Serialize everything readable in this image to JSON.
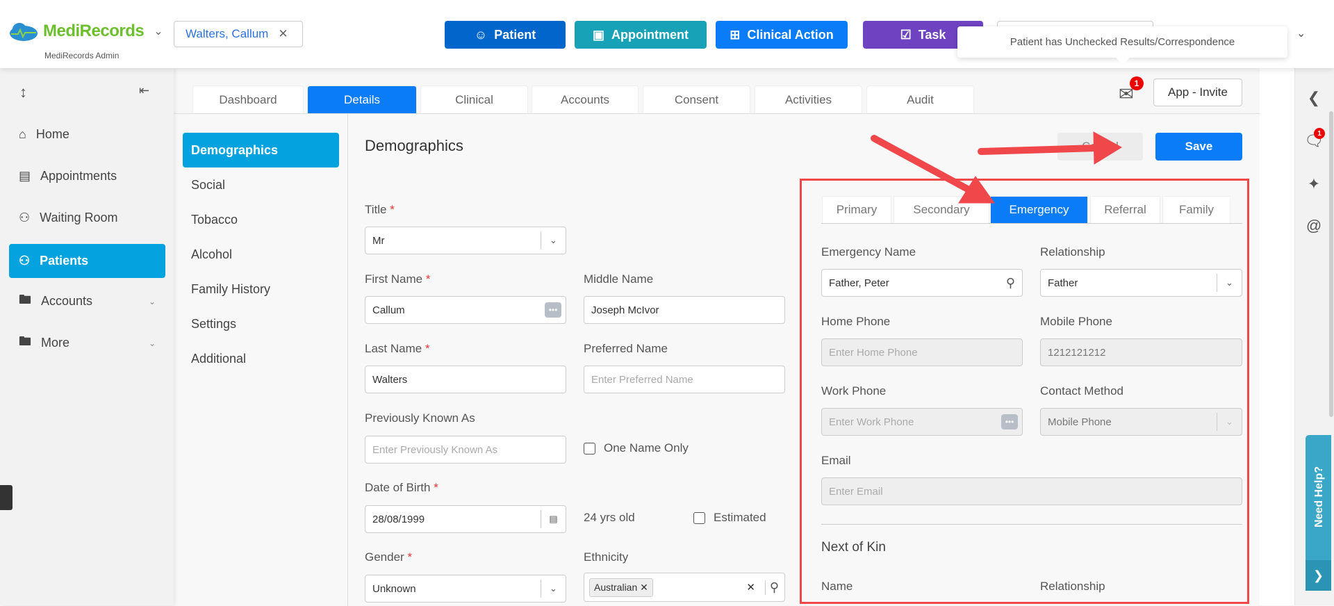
{
  "header": {
    "brand": "MediRecords",
    "subtitle": "MediRecords Admin",
    "patient_chip": "Walters, Callum",
    "buttons": [
      {
        "label": "Patient",
        "color": "#0066cc"
      },
      {
        "label": "Appointment",
        "color": "#17a2b8"
      },
      {
        "label": "Clinical Action",
        "color": "#0a7cf7"
      },
      {
        "label": "Task",
        "color": "#6f42c1"
      }
    ],
    "tooltip": "Patient has Unchecked Results/Correspondence"
  },
  "sidebar": {
    "items": [
      {
        "label": "Home"
      },
      {
        "label": "Appointments"
      },
      {
        "label": "Waiting Room"
      },
      {
        "label": "Patients"
      },
      {
        "label": "Accounts"
      },
      {
        "label": "More"
      }
    ]
  },
  "tabs": [
    "Dashboard",
    "Details",
    "Clinical",
    "Accounts",
    "Consent",
    "Activities",
    "Audit"
  ],
  "mail_badge": "1",
  "app_invite": "App - Invite",
  "subnav": [
    "Demographics",
    "Social",
    "Tobacco",
    "Alcohol",
    "Family History",
    "Settings",
    "Additional"
  ],
  "form": {
    "heading": "Demographics",
    "cancel": "Cancel",
    "save": "Save",
    "title_label": "Title",
    "title_value": "Mr",
    "first_name_label": "First Name",
    "first_name": "Callum",
    "middle_name_label": "Middle Name",
    "middle_name": "Joseph McIvor",
    "last_name_label": "Last Name",
    "last_name": "Walters",
    "preferred_label": "Preferred Name",
    "preferred_ph": "Enter Preferred Name",
    "pka_label": "Previously Known As",
    "pka_ph": "Enter Previously Known As",
    "one_name": "One Name Only",
    "dob_label": "Date of Birth",
    "dob": "28/08/1999",
    "age": "24 yrs old",
    "estimated": "Estimated",
    "gender_label": "Gender",
    "gender": "Unknown",
    "ethnicity_label": "Ethnicity",
    "ethnicity_tag": "Australian",
    "req": "*"
  },
  "contact": {
    "tabs": [
      "Primary",
      "Secondary",
      "Emergency",
      "Referral",
      "Family"
    ],
    "em_name_label": "Emergency Name",
    "em_name": "Father, Peter",
    "rel_label": "Relationship",
    "rel": "Father",
    "home_label": "Home Phone",
    "home_ph": "Enter Home Phone",
    "mobile_label": "Mobile Phone",
    "mobile": "1212121212",
    "work_label": "Work Phone",
    "work_ph": "Enter Work Phone",
    "method_label": "Contact Method",
    "method": "Mobile Phone",
    "email_label": "Email",
    "email_ph": "Enter Email",
    "nok": "Next of Kin",
    "nok_name": "Name",
    "nok_rel": "Relationship"
  },
  "right": {
    "chat_badge": "1",
    "help": "Need Help?"
  }
}
